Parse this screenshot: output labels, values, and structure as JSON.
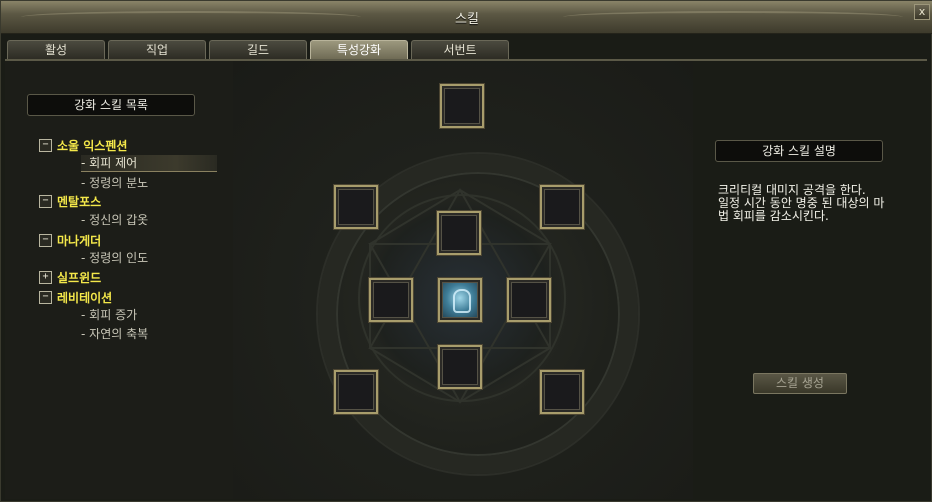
{
  "window": {
    "title": "스킬",
    "close_label": "x"
  },
  "tabs": [
    {
      "label": "활성"
    },
    {
      "label": "직업"
    },
    {
      "label": "길드"
    },
    {
      "label": "특성강화",
      "active": true
    },
    {
      "label": "서번트"
    }
  ],
  "skill_list": {
    "header": "강화 스킬 목록",
    "categories": [
      {
        "toggle": "−",
        "label": "소울 익스펜션",
        "children": [
          "회피 제어",
          "정령의 분노"
        ]
      },
      {
        "toggle": "−",
        "label": "멘탈포스",
        "children": [
          "정신의 갑옷"
        ]
      },
      {
        "toggle": "−",
        "label": "마나게더",
        "children": [
          "정령의 인도"
        ]
      },
      {
        "toggle": "+",
        "label": "실프윈드",
        "children": []
      },
      {
        "toggle": "−",
        "label": "레비테이션",
        "children": [
          "회피 증가",
          "자연의 축복"
        ]
      }
    ],
    "selected": "회피 제어",
    "bullet": "-"
  },
  "description": {
    "header": "강화 스킬 설명",
    "text": "크리티컬 대미지 공격을 한다.\n일정 시간 동안 명중 된 대상의 마법 회피를 감소시킨다."
  },
  "create_button": {
    "label": "스킬 생성"
  },
  "colors": {
    "category": "#f4e84a",
    "slot_border": "#a89d6c",
    "active_slot": "#3f7d98"
  }
}
